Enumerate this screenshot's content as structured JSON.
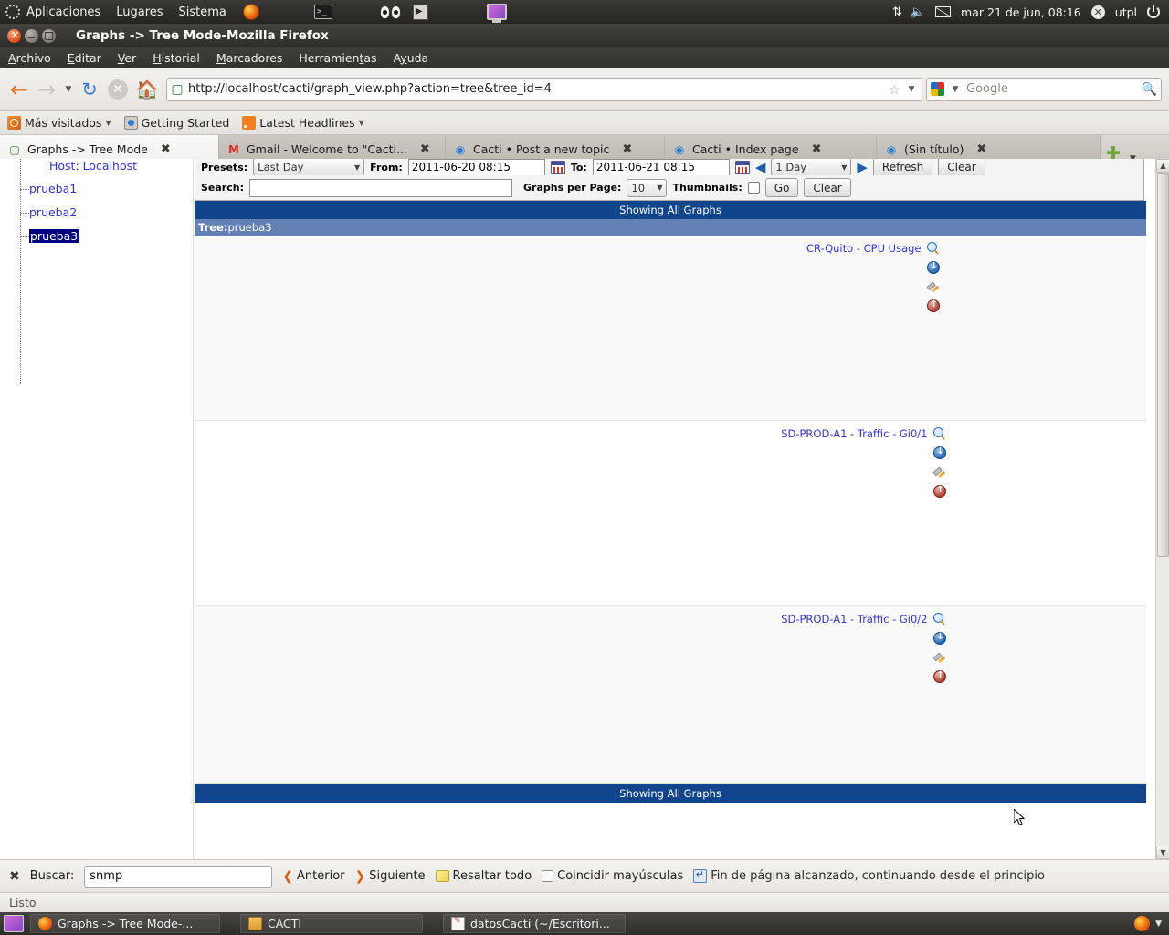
{
  "desktop": {
    "panel": {
      "menus": [
        "Aplicaciones",
        "Lugares",
        "Sistema"
      ],
      "clock": "mar 21 de jun, 08:16",
      "user": "utpl"
    },
    "taskbar": {
      "items": [
        {
          "label": "Graphs -> Tree Mode-...",
          "icon": "firefox-icon"
        },
        {
          "label": "CACTI",
          "icon": "folder-icon"
        },
        {
          "label": "datosCacti (~/Escritori...",
          "icon": "document-icon"
        }
      ]
    }
  },
  "window": {
    "title": "Graphs -> Tree Mode-Mozilla Firefox",
    "buttons": {
      "close": "close",
      "minimize": "minimize",
      "maximize": "maximize"
    }
  },
  "menubar": [
    {
      "label": "Archivo",
      "accel": "A"
    },
    {
      "label": "Editar",
      "accel": "E"
    },
    {
      "label": "Ver",
      "accel": "V"
    },
    {
      "label": "Historial",
      "accel": "H"
    },
    {
      "label": "Marcadores",
      "accel": "M"
    },
    {
      "label": "Herramientas",
      "accel": "t"
    },
    {
      "label": "Ayuda",
      "accel": "y"
    }
  ],
  "navbar": {
    "url": "http://localhost/cacti/graph_view.php?action=tree&tree_id=4",
    "search_placeholder": "Google",
    "search_engine": "Google"
  },
  "bookmarks": [
    {
      "label": "Más visitados",
      "icon": "most-visited-icon",
      "has_caret": true
    },
    {
      "label": "Getting Started",
      "icon": "getting-started-icon",
      "has_caret": false
    },
    {
      "label": "Latest Headlines",
      "icon": "rss-icon",
      "has_caret": true
    }
  ],
  "tabs": [
    {
      "label": "Graphs -> Tree Mode",
      "active": true,
      "icon": "cacti-icon"
    },
    {
      "label": "Gmail - Welcome to \"Cacti...",
      "active": false,
      "icon": "gmail-icon"
    },
    {
      "label": "Cacti • Post a new topic",
      "active": false,
      "icon": "forum-icon"
    },
    {
      "label": "Cacti • Index page",
      "active": false,
      "icon": "forum-icon"
    },
    {
      "label": "(Sin título)",
      "active": false,
      "icon": "forum-icon"
    }
  ],
  "sidebar": {
    "nodes": [
      {
        "label": "Host: Localhost",
        "selected": false,
        "clipped": true
      },
      {
        "label": "prueba1",
        "selected": false
      },
      {
        "label": "prueba2",
        "selected": false
      },
      {
        "label": "prueba3",
        "selected": true
      }
    ]
  },
  "cacti": {
    "toolbar": {
      "presets_label": "Presets:",
      "presets_value": "Last Day",
      "from_label": "From:",
      "from_value": "2011-06-20 08:15",
      "to_label": "To:",
      "to_value": "2011-06-21 08:15",
      "interval_value": "1 Day",
      "refresh_label": "Refresh",
      "clear_label": "Clear",
      "search_label": "Search:",
      "search_value": "",
      "graphs_per_page_label": "Graphs per Page:",
      "graphs_per_page_value": "10",
      "thumbnails_label": "Thumbnails:",
      "go_label": "Go",
      "clear2_label": "Clear"
    },
    "header_top": "Showing All Graphs",
    "header_bottom": "Showing All Graphs",
    "tree_label": "Tree:",
    "tree_name": "prueba3",
    "graphs": [
      {
        "title": "CR-Quito - CPU Usage"
      },
      {
        "title": "SD-PROD-A1 - Traffic - Gi0/1"
      },
      {
        "title": "SD-PROD-A1 - Traffic - Gi0/2"
      }
    ],
    "graph_actions": [
      "zoom-icon",
      "csv-export-icon",
      "graph-properties-icon",
      "page-top-icon"
    ]
  },
  "findbar": {
    "label": "Buscar:",
    "value": "snmp",
    "previous": "Anterior",
    "next": "Siguiente",
    "highlight_all": "Resaltar todo",
    "match_case": "Coincidir mayúsculas",
    "wrap_message": "Fin de página alcanzado, continuando desde el principio"
  },
  "statusbar": {
    "text": "Listo"
  }
}
